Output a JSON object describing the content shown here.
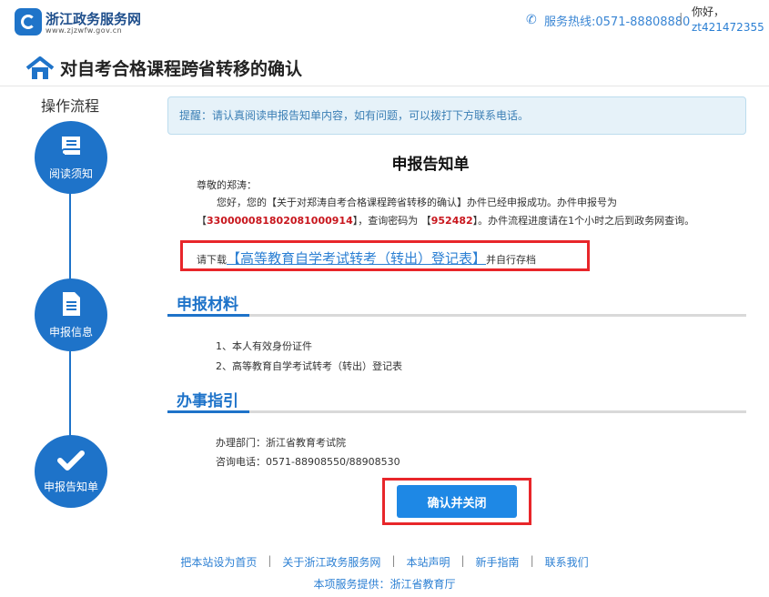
{
  "header": {
    "site_name": "浙江政务服务网",
    "site_url": "www.zjzwfw.gov.cn",
    "hotline": "服务热线:0571-88808880",
    "separator": "|",
    "greeting": "你好，",
    "username": "zt421472355"
  },
  "page_title": "对自考合格课程跨省转移的确认",
  "steps": {
    "title": "操作流程",
    "items": [
      {
        "label": "阅读须知",
        "icon": "book-icon"
      },
      {
        "label": "申报信息",
        "icon": "document-icon"
      },
      {
        "label": "申报告知单",
        "icon": "check-icon"
      }
    ]
  },
  "notice": "提醒：请认真阅读申报告知单内容，如有问题，可以拨打下方联系电话。",
  "doc": {
    "title": "申报告知单",
    "dear": "尊敬的郑涛：",
    "para_1": "您好，您的【关于对郑涛自考合格课程跨省转移的确认】办件已经申报成功。办件申报号为【",
    "case_no": "330000081802081000914",
    "para_2": "】，查询密码为 【",
    "password": "952482",
    "para_3": "】。办件流程进度请在1个小时之后到政务网查询。",
    "download_prefix": "请下载",
    "download_link": "【高等教育自学考试转考（转出）登记表】",
    "download_suffix": "并自行存档"
  },
  "materials": {
    "heading": "申报材料",
    "items": [
      "1、本人有效身份证件",
      "2、高等教育自学考试转考（转出）登记表"
    ]
  },
  "guide": {
    "heading": "办事指引",
    "dept": "办理部门：浙江省教育考试院",
    "phone": "咨询电话：0571-88908550/88908530"
  },
  "confirm_button": "确认并关闭",
  "footer": {
    "links": [
      "把本站设为首页",
      "关于浙江政务服务网",
      "本站声明",
      "新手指南",
      "联系我们"
    ],
    "separator": "|",
    "line2": "本项服务提供：浙江省教育厅"
  }
}
